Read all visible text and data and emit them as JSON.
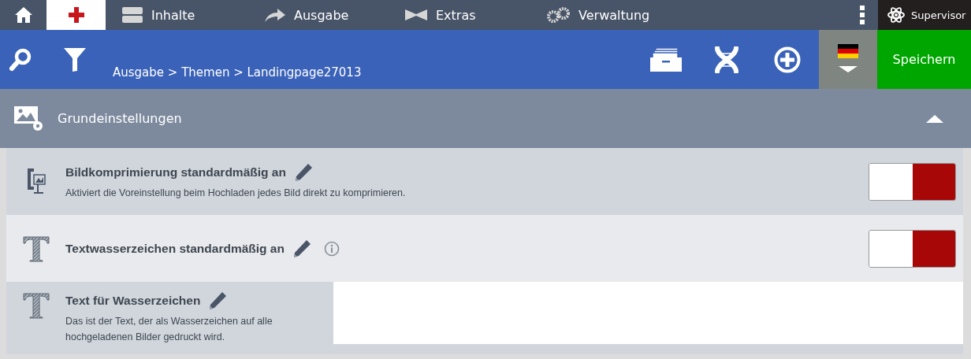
{
  "top_nav": {
    "items": [
      {
        "kind": "home",
        "selected": false
      },
      {
        "kind": "cross",
        "selected": true
      },
      {
        "kind": "content",
        "label": "Inhalte",
        "selected": false
      },
      {
        "kind": "output",
        "label": "Ausgabe",
        "selected": false
      },
      {
        "kind": "extras",
        "label": "Extras",
        "selected": false
      },
      {
        "kind": "admin",
        "label": "Verwaltung",
        "selected": false
      }
    ],
    "user": "Supervisor"
  },
  "toolbar": {
    "breadcrumb": "Ausgabe > Themen > Landingpage27013",
    "save": "Speichern"
  },
  "section": {
    "title": "Grundeinstellungen",
    "expanded": true
  },
  "settings": [
    {
      "kind": "toggle",
      "title": "Bildkomprimierung standardmäßig an",
      "description": "Aktiviert die Voreinstellung beim Hochladen jedes Bild direkt zu komprimieren.",
      "info": false,
      "on": false
    },
    {
      "kind": "toggle",
      "title": "Textwasserzeichen standardmäßig an",
      "info": true,
      "on": false
    },
    {
      "kind": "textarea",
      "title": "Text für Wasserzeichen",
      "description": "Das ist der Text, der als Wasserzeichen auf alle hochgeladenen Bilder gedruckt wird.",
      "info": false
    }
  ]
}
